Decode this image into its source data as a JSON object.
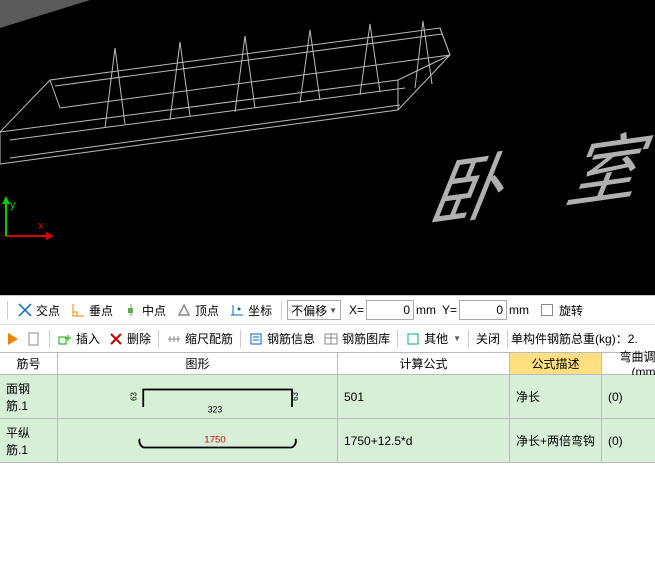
{
  "viewport": {
    "ucs_x": "x",
    "ucs_y": "y",
    "big_label": "卧 室"
  },
  "snap_toolbar": {
    "intersect": "交点",
    "perp": "垂点",
    "midpoint": "中点",
    "vertex": "顶点",
    "coord": "坐标",
    "offset_mode": "不偏移",
    "x_lbl": "X=",
    "x_val": "0",
    "x_unit": "mm",
    "y_lbl": "Y=",
    "y_val": "0",
    "y_unit": "mm",
    "rotate": "旋转"
  },
  "action_toolbar": {
    "insert": "插入",
    "delete": "删除",
    "scale": "缩尺配筋",
    "rebar_info": "钢筋信息",
    "rebar_lib": "钢筋图库",
    "other": "其他",
    "close": "关闭",
    "total_label": "单构件钢筋总重(kg)：",
    "total_value": "2."
  },
  "table": {
    "headers": {
      "num": "筋号",
      "shape": "图形",
      "formula": "计算公式",
      "desc": "公式描述",
      "bend": "弯曲调整(mm"
    },
    "rows": [
      {
        "num": "面钢筋.1",
        "shape": {
          "left": "63",
          "right": "63",
          "bottom": "323"
        },
        "formula": "501",
        "desc": "净长",
        "bend": "(0)"
      },
      {
        "num": "平纵筋.1",
        "shape": {
          "length": "1750"
        },
        "formula": "1750+12.5*d",
        "desc": "净长+两倍弯钩",
        "bend": "(0)"
      }
    ]
  }
}
